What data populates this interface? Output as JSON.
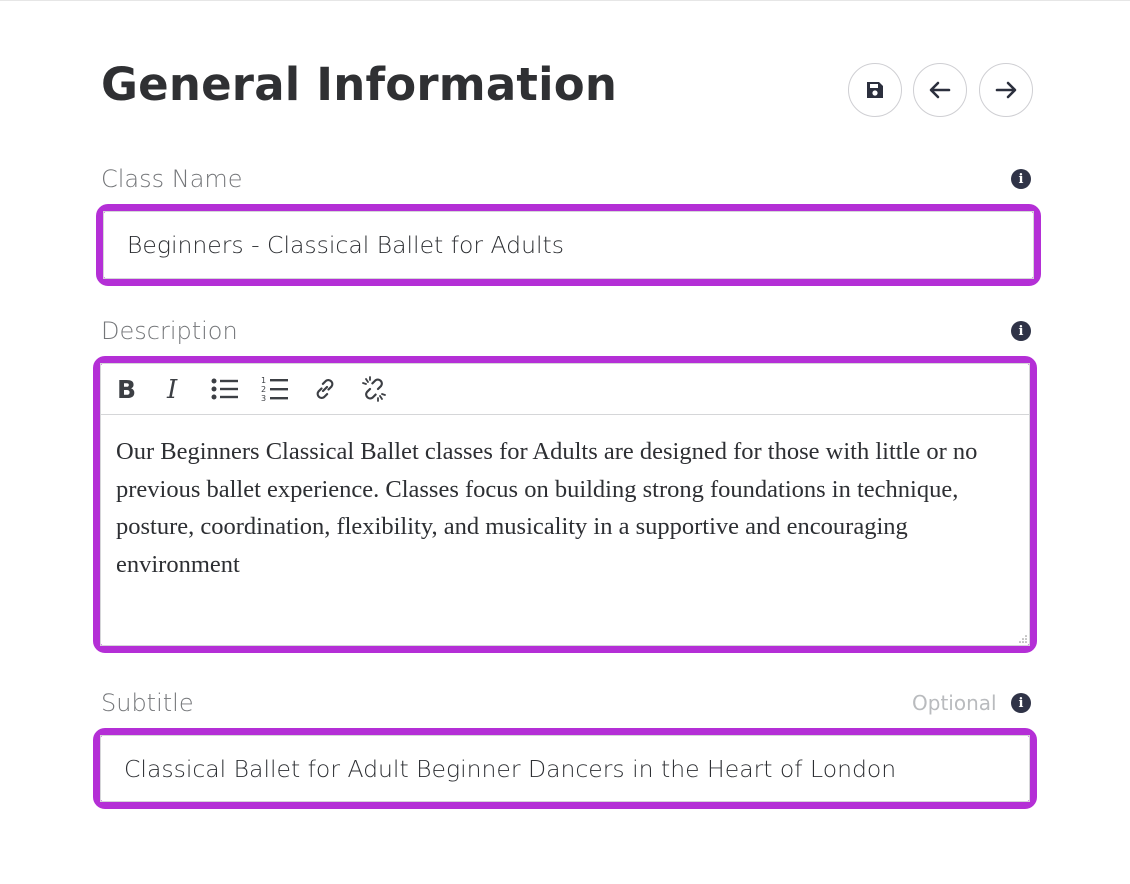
{
  "page": {
    "title": "General Information"
  },
  "toolbar_actions": [
    {
      "name": "save-icon"
    },
    {
      "name": "arrow-left-icon"
    },
    {
      "name": "arrow-right-icon"
    }
  ],
  "class_name": {
    "label": "Class Name",
    "value": "Beginners - Classical Ballet for Adults"
  },
  "description": {
    "label": "Description",
    "text": "Our Beginners Classical Ballet classes for Adults are designed for those with little or no previous ballet experience. Classes focus on building strong foundations in technique, posture, coordination, flexibility, and musicality in a supportive and encouraging environment",
    "toolbar": [
      "bold-icon",
      "italic-icon",
      "bullet-list-icon",
      "numbered-list-icon",
      "link-icon",
      "unlink-icon"
    ]
  },
  "subtitle": {
    "label": "Subtitle",
    "optional": "Optional",
    "value": "Classical Ballet for Adult Beginner Dancers in the Heart of London"
  },
  "info_glyph": "i",
  "colors": {
    "highlight": "#b42fd6",
    "info": "#2f3347",
    "label": "#747679"
  }
}
